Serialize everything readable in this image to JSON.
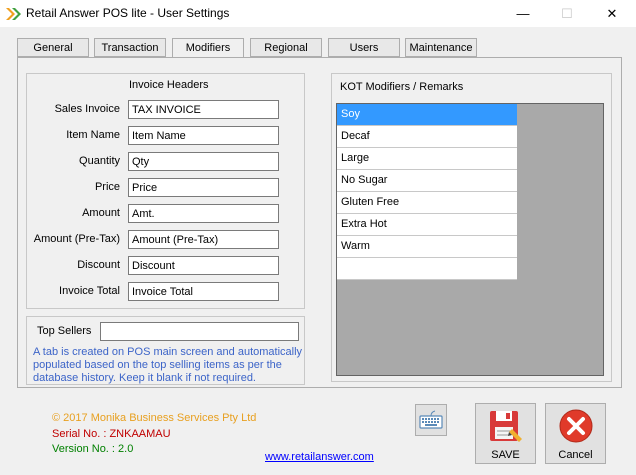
{
  "window": {
    "title": "Retail Answer POS lite - User Settings",
    "minimize": "—",
    "maximize": "☐",
    "close": "✕"
  },
  "tabs": [
    {
      "label": "General"
    },
    {
      "label": "Transaction"
    },
    {
      "label": "Modifiers",
      "active": true
    },
    {
      "label": "Regional"
    },
    {
      "label": "Users"
    },
    {
      "label": "Maintenance"
    }
  ],
  "invoice_headers": {
    "title": "Invoice Headers",
    "fields": [
      {
        "label": "Sales Invoice",
        "value": "TAX INVOICE"
      },
      {
        "label": "Item Name",
        "value": "Item Name"
      },
      {
        "label": "Quantity",
        "value": "Qty"
      },
      {
        "label": "Price",
        "value": "Price"
      },
      {
        "label": "Amount",
        "value": "Amt."
      },
      {
        "label": "Amount (Pre-Tax)",
        "value": "Amount (Pre-Tax)"
      },
      {
        "label": "Discount",
        "value": "Discount"
      },
      {
        "label": "Invoice Total",
        "value": "Invoice Total"
      }
    ]
  },
  "top_sellers": {
    "label": "Top Sellers",
    "value": "",
    "info_line1": "A tab is created on POS main screen and automatically",
    "info_line2": "populated based on the top selling items as per the",
    "info_line3": "database history. Keep it blank if not required."
  },
  "kot": {
    "title": "KOT Modifiers / Remarks",
    "items": [
      "Soy",
      "Decaf",
      "Large",
      "No Sugar",
      "Gluten Free",
      "Extra Hot",
      "Warm",
      ""
    ],
    "selected_index": 0
  },
  "footer": {
    "copyright": "© 2017 Monika Business Services Pty Ltd",
    "serial": "Serial No. : ZNKAAMAU",
    "version": "Version No. : 2.0",
    "link": "www.retailanswer.com"
  },
  "buttons": {
    "save": "SAVE",
    "cancel": "Cancel"
  },
  "colors": {
    "copyright": "#e8a020",
    "serial": "#c00000",
    "version": "#008000",
    "info": "#3c64c8",
    "selected": "#3399ff"
  }
}
